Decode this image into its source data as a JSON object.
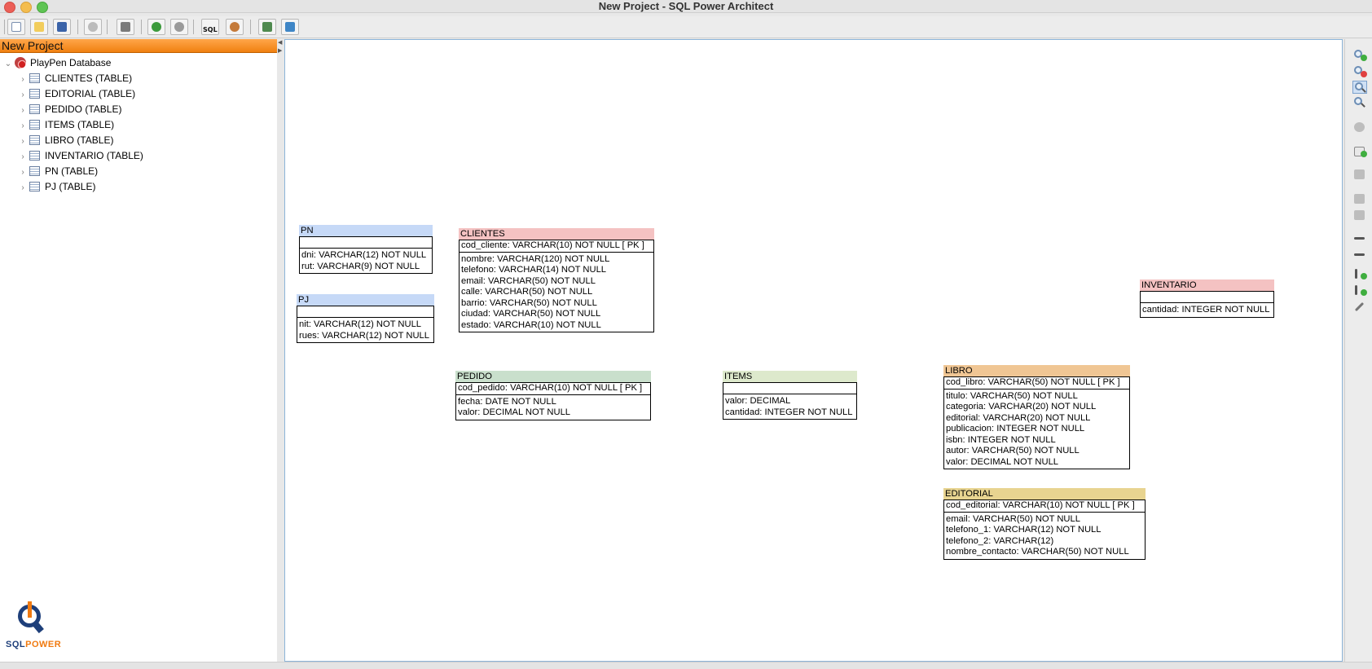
{
  "window": {
    "title": "New Project - SQL Power Architect"
  },
  "toolbar": {
    "buttons": [
      {
        "name": "new-project-button",
        "icon": "new-file-icon"
      },
      {
        "name": "open-project-button",
        "icon": "folder-icon"
      },
      {
        "name": "save-project-button",
        "icon": "save-icon"
      },
      {
        "name": "refresh-button",
        "icon": "refresh-icon"
      },
      {
        "name": "print-button",
        "icon": "printer-icon"
      },
      {
        "name": "undo-button",
        "icon": "undo-icon"
      },
      {
        "name": "redo-button",
        "icon": "redo-icon"
      },
      {
        "name": "forward-engineer-sql-button",
        "icon": "sql-icon",
        "text": "SQL"
      },
      {
        "name": "compare-dm-button",
        "icon": "database-compare-icon"
      },
      {
        "name": "data-mover-button",
        "icon": "data-mover-icon"
      },
      {
        "name": "profile-button",
        "icon": "bar-chart-icon"
      }
    ]
  },
  "tree": {
    "header": "New Project",
    "root": "PlayPen Database",
    "items": [
      "CLIENTES (TABLE)",
      "EDITORIAL (TABLE)",
      "PEDIDO (TABLE)",
      "ITEMS (TABLE)",
      "LIBRO (TABLE)",
      "INVENTARIO (TABLE)",
      "PN (TABLE)",
      "PJ (TABLE)"
    ]
  },
  "logo": {
    "part1": "SQL",
    "part2": "POWER"
  },
  "playpen": {
    "tables": [
      {
        "id": "pn",
        "name": "PN",
        "pk": [],
        "columns": [
          "dni: VARCHAR(12)   NOT NULL",
          "rut: VARCHAR(9)   NOT NULL"
        ]
      },
      {
        "id": "pj",
        "name": "PJ",
        "pk": [],
        "columns": [
          "nit: VARCHAR(12)   NOT NULL",
          "rues: VARCHAR(12)   NOT NULL"
        ]
      },
      {
        "id": "clientes",
        "name": "CLIENTES",
        "pk": [
          "cod_cliente: VARCHAR(10)   NOT NULL  [ PK ]"
        ],
        "columns": [
          "nombre: VARCHAR(120)   NOT NULL",
          "telefono: VARCHAR(14)   NOT NULL",
          "email: VARCHAR(50)   NOT NULL",
          "calle: VARCHAR(50)   NOT NULL",
          "barrio: VARCHAR(50)   NOT NULL",
          "ciudad: VARCHAR(50)   NOT NULL",
          "estado: VARCHAR(10)   NOT NULL"
        ]
      },
      {
        "id": "pedido",
        "name": "PEDIDO",
        "pk": [
          "cod_pedido: VARCHAR(10)   NOT NULL  [ PK ]"
        ],
        "columns": [
          "fecha: DATE   NOT NULL",
          "valor: DECIMAL   NOT NULL"
        ]
      },
      {
        "id": "items",
        "name": "ITEMS",
        "pk": [],
        "columns": [
          "valor: DECIMAL",
          "cantidad: INTEGER   NOT NULL"
        ]
      },
      {
        "id": "inventario",
        "name": "INVENTARIO",
        "pk": [],
        "columns": [
          "cantidad: INTEGER   NOT NULL"
        ]
      },
      {
        "id": "libro",
        "name": "LIBRO",
        "pk": [
          "cod_libro: VARCHAR(50)   NOT NULL  [ PK ]"
        ],
        "columns": [
          "titulo: VARCHAR(50)   NOT NULL",
          "categoria: VARCHAR(20)   NOT NULL",
          "editorial: VARCHAR(20)   NOT NULL",
          "publicacion: INTEGER   NOT NULL",
          "isbn: INTEGER   NOT NULL",
          "autor: VARCHAR(50)   NOT NULL",
          "valor: DECIMAL   NOT NULL"
        ]
      },
      {
        "id": "editorial",
        "name": "EDITORIAL",
        "pk": [
          "cod_editorial: VARCHAR(10)   NOT NULL  [ PK ]"
        ],
        "columns": [
          "email: VARCHAR(50)   NOT NULL",
          "telefono_1: VARCHAR(12)   NOT NULL",
          "telefono_2: VARCHAR(12)",
          "nombre_contacto: VARCHAR(50)   NOT NULL"
        ]
      }
    ]
  },
  "rightbar": {
    "buttons": [
      "zoom-in-icon",
      "zoom-out-icon",
      "zoom-normal-icon",
      "zoom-to-fit-icon",
      "select-all-icon",
      "new-table-icon",
      "insert-column-icon",
      "edit-icon",
      "new-relationship-icon",
      "identifying-relationship-icon",
      "comment-icon",
      "insert-index-icon",
      "add-column-icon",
      "edit-pencil-icon"
    ]
  },
  "colors": {
    "tree_header": "#f08010",
    "table_pn": "#c6d9f7",
    "table_pj": "#c6d9f7",
    "table_clientes": "#f4c2c2",
    "table_pedido": "#c9dfcc",
    "table_items": "#dde9cc",
    "table_inventario": "#f4c2c2",
    "table_libro": "#f0c694",
    "table_editorial": "#e8d490",
    "canvas_border": "#8cb4d8"
  }
}
